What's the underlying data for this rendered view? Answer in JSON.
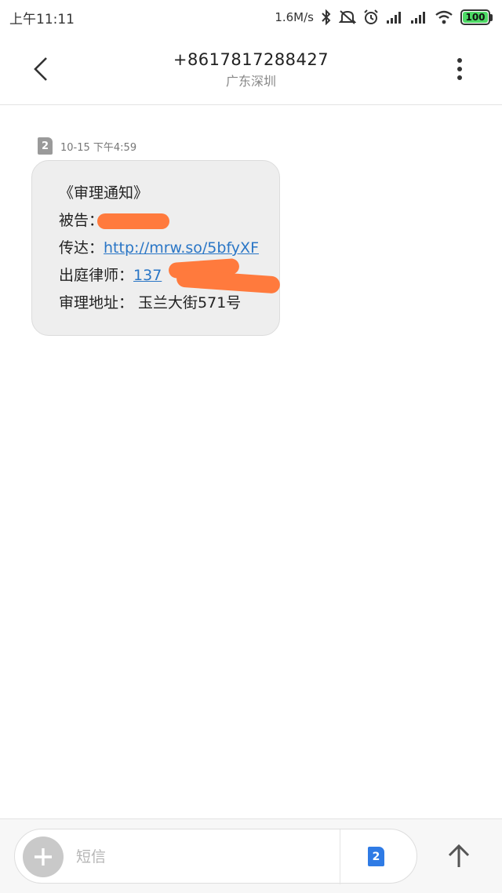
{
  "status_bar": {
    "time": "上午11:11",
    "net_speed": "1.6M/s",
    "battery": "100",
    "icons": [
      "bluetooth-icon",
      "mute-icon",
      "alarm-icon",
      "signal-icon",
      "signal-icon",
      "wifi-icon",
      "battery-icon"
    ]
  },
  "header": {
    "number": "+8617817288427",
    "location": "广东深圳",
    "back_icon": "chevron-left-icon",
    "more_icon": "more-vertical-icon"
  },
  "message": {
    "sim_slot": "2",
    "time": "10-15 下午4:59",
    "title": "《审理通知》",
    "defendant_label": "被告：",
    "service_label": "传达：",
    "service_link": "http://mrw.so/5bfyXF",
    "lawyer_label": "出庭律师：",
    "lawyer_phone_visible": "137",
    "address_label": "审理地址：",
    "address_value": "玉兰大街571号",
    "redaction_color": "#ff7a3d"
  },
  "composer": {
    "placeholder": "短信",
    "sim_slot": "2",
    "add_icon": "plus-icon",
    "send_icon": "arrow-up-icon"
  },
  "colors": {
    "accent": "#2f7be5",
    "link": "#2a76c6",
    "battery": "#4cd964"
  }
}
